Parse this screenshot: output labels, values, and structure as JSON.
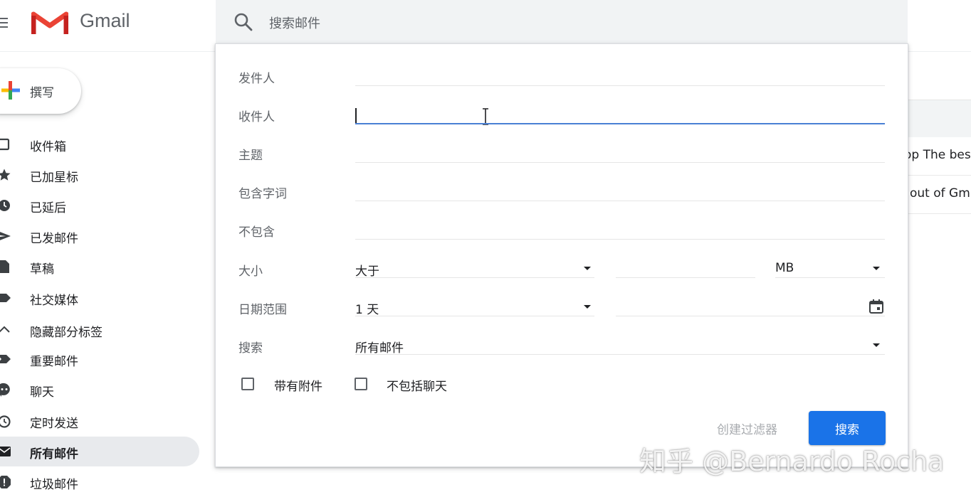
{
  "app": {
    "name": "Gmail"
  },
  "search": {
    "placeholder": "搜索邮件"
  },
  "sidebar": {
    "compose_label": "撰写",
    "items": [
      {
        "label": "收件箱",
        "icon": "inbox-icon"
      },
      {
        "label": "已加星标",
        "icon": "star-icon"
      },
      {
        "label": "已延后",
        "icon": "clock-icon"
      },
      {
        "label": "已发邮件",
        "icon": "send-icon"
      },
      {
        "label": "草稿",
        "icon": "draft-icon"
      },
      {
        "label": "社交媒体",
        "icon": "label-icon"
      },
      {
        "label": "隐藏部分标签",
        "icon": "chevron-up-icon"
      },
      {
        "label": "重要邮件",
        "icon": "important-icon"
      },
      {
        "label": "聊天",
        "icon": "chat-icon"
      },
      {
        "label": "定时发送",
        "icon": "scheduled-icon"
      },
      {
        "label": "所有邮件",
        "icon": "mail-icon",
        "active": true
      },
      {
        "label": "垃圾邮件",
        "icon": "spam-icon"
      }
    ]
  },
  "email_list": {
    "rows": [
      {
        "snippet": "op The bes"
      },
      {
        "snippet": "out of Gm"
      }
    ]
  },
  "advanced_search": {
    "from_label": "发件人",
    "to_label": "收件人",
    "subject_label": "主题",
    "has_words_label": "包含字词",
    "not_has_label": "不包含",
    "size_label": "大小",
    "size_operator": "大于",
    "size_unit": "MB",
    "date_label": "日期范围",
    "date_value": "1 天",
    "search_in_label": "搜索",
    "search_in_value": "所有邮件",
    "has_attachment_label": "带有附件",
    "exclude_chats_label": "不包括聊天",
    "create_filter_label": "创建过滤器",
    "search_button_label": "搜索"
  },
  "watermark": "知乎 @Bernardo Rocha",
  "colors": {
    "accent": "#1a73e8",
    "focus_line": "#4a80d4",
    "active_nav": "#e8eaed"
  }
}
